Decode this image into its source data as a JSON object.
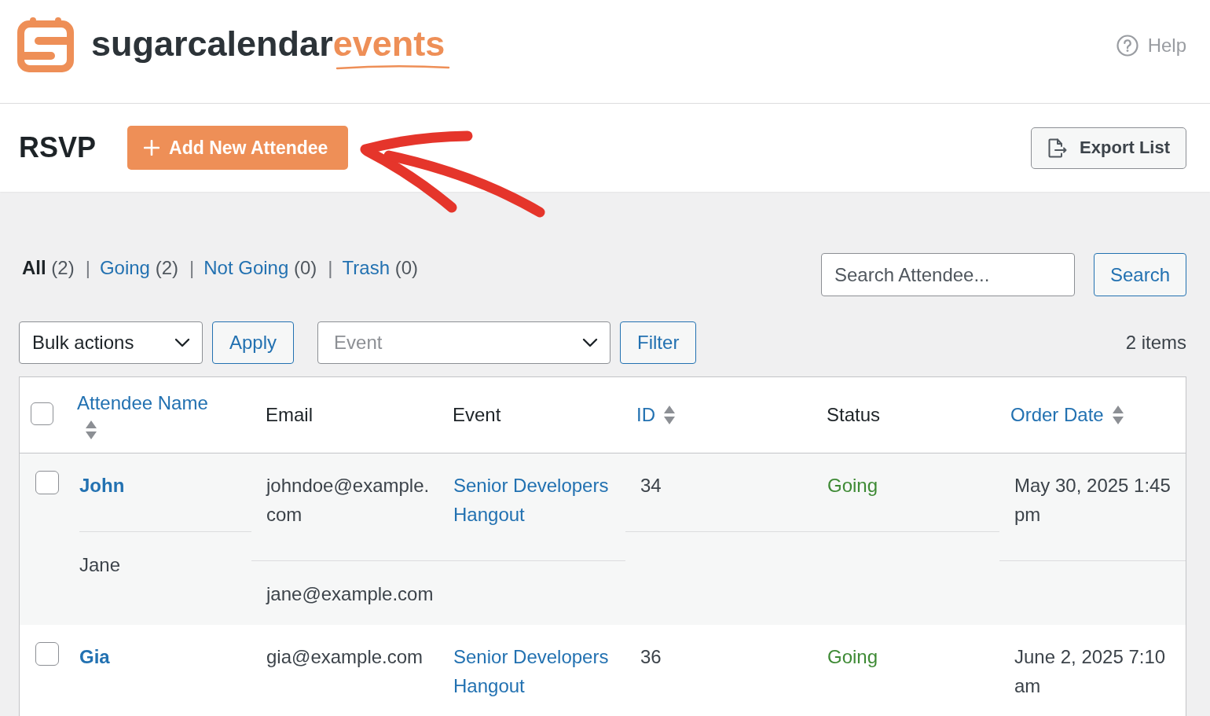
{
  "header": {
    "logo": {
      "text": "sugarcalendar",
      "accent": "events"
    },
    "help_link": "Help"
  },
  "toolbar": {
    "title": "RSVP",
    "add_button": "Add New Attendee",
    "export_button": "Export List"
  },
  "views": {
    "separator": "|",
    "items": [
      {
        "label": "All",
        "count": "(2)",
        "selected": true
      },
      {
        "label": "Going",
        "count": "(2)",
        "selected": false
      },
      {
        "label": "Not Going",
        "count": "(0)",
        "selected": false
      },
      {
        "label": "Trash",
        "count": "(0)",
        "selected": false
      }
    ]
  },
  "search": {
    "placeholder": "Search Attendee...",
    "button": "Search"
  },
  "bulk_actions": {
    "value": "Bulk actions",
    "button": "Apply"
  },
  "event_filter": {
    "placeholder": "Event",
    "button": "Filter"
  },
  "item_count": "2 items",
  "table": {
    "select_all": {
      "checked": false
    },
    "columns": [
      {
        "label": "Attendee Name",
        "sortable": true
      },
      {
        "label": "Email",
        "sortable": false
      },
      {
        "label": "Event",
        "sortable": false
      },
      {
        "label": "ID",
        "sortable": true
      },
      {
        "label": "Status",
        "sortable": false
      },
      {
        "label": "Order Date",
        "sortable": true
      }
    ],
    "rows": [
      {
        "checked": false,
        "name": "John",
        "email": "johndoe@example.com",
        "event": "Senior Developers Hangout",
        "id": "34",
        "status": "Going",
        "order_date": "May 30, 2025 1:45 pm",
        "guests": [
          {
            "name": "Jane",
            "email": "jane@example.com"
          }
        ]
      },
      {
        "checked": false,
        "name": "Gia",
        "email": "gia@example.com",
        "event": "Senior Developers Hangout",
        "id": "36",
        "status": "Going",
        "order_date": "June 2, 2025 7:10 am"
      }
    ]
  }
}
